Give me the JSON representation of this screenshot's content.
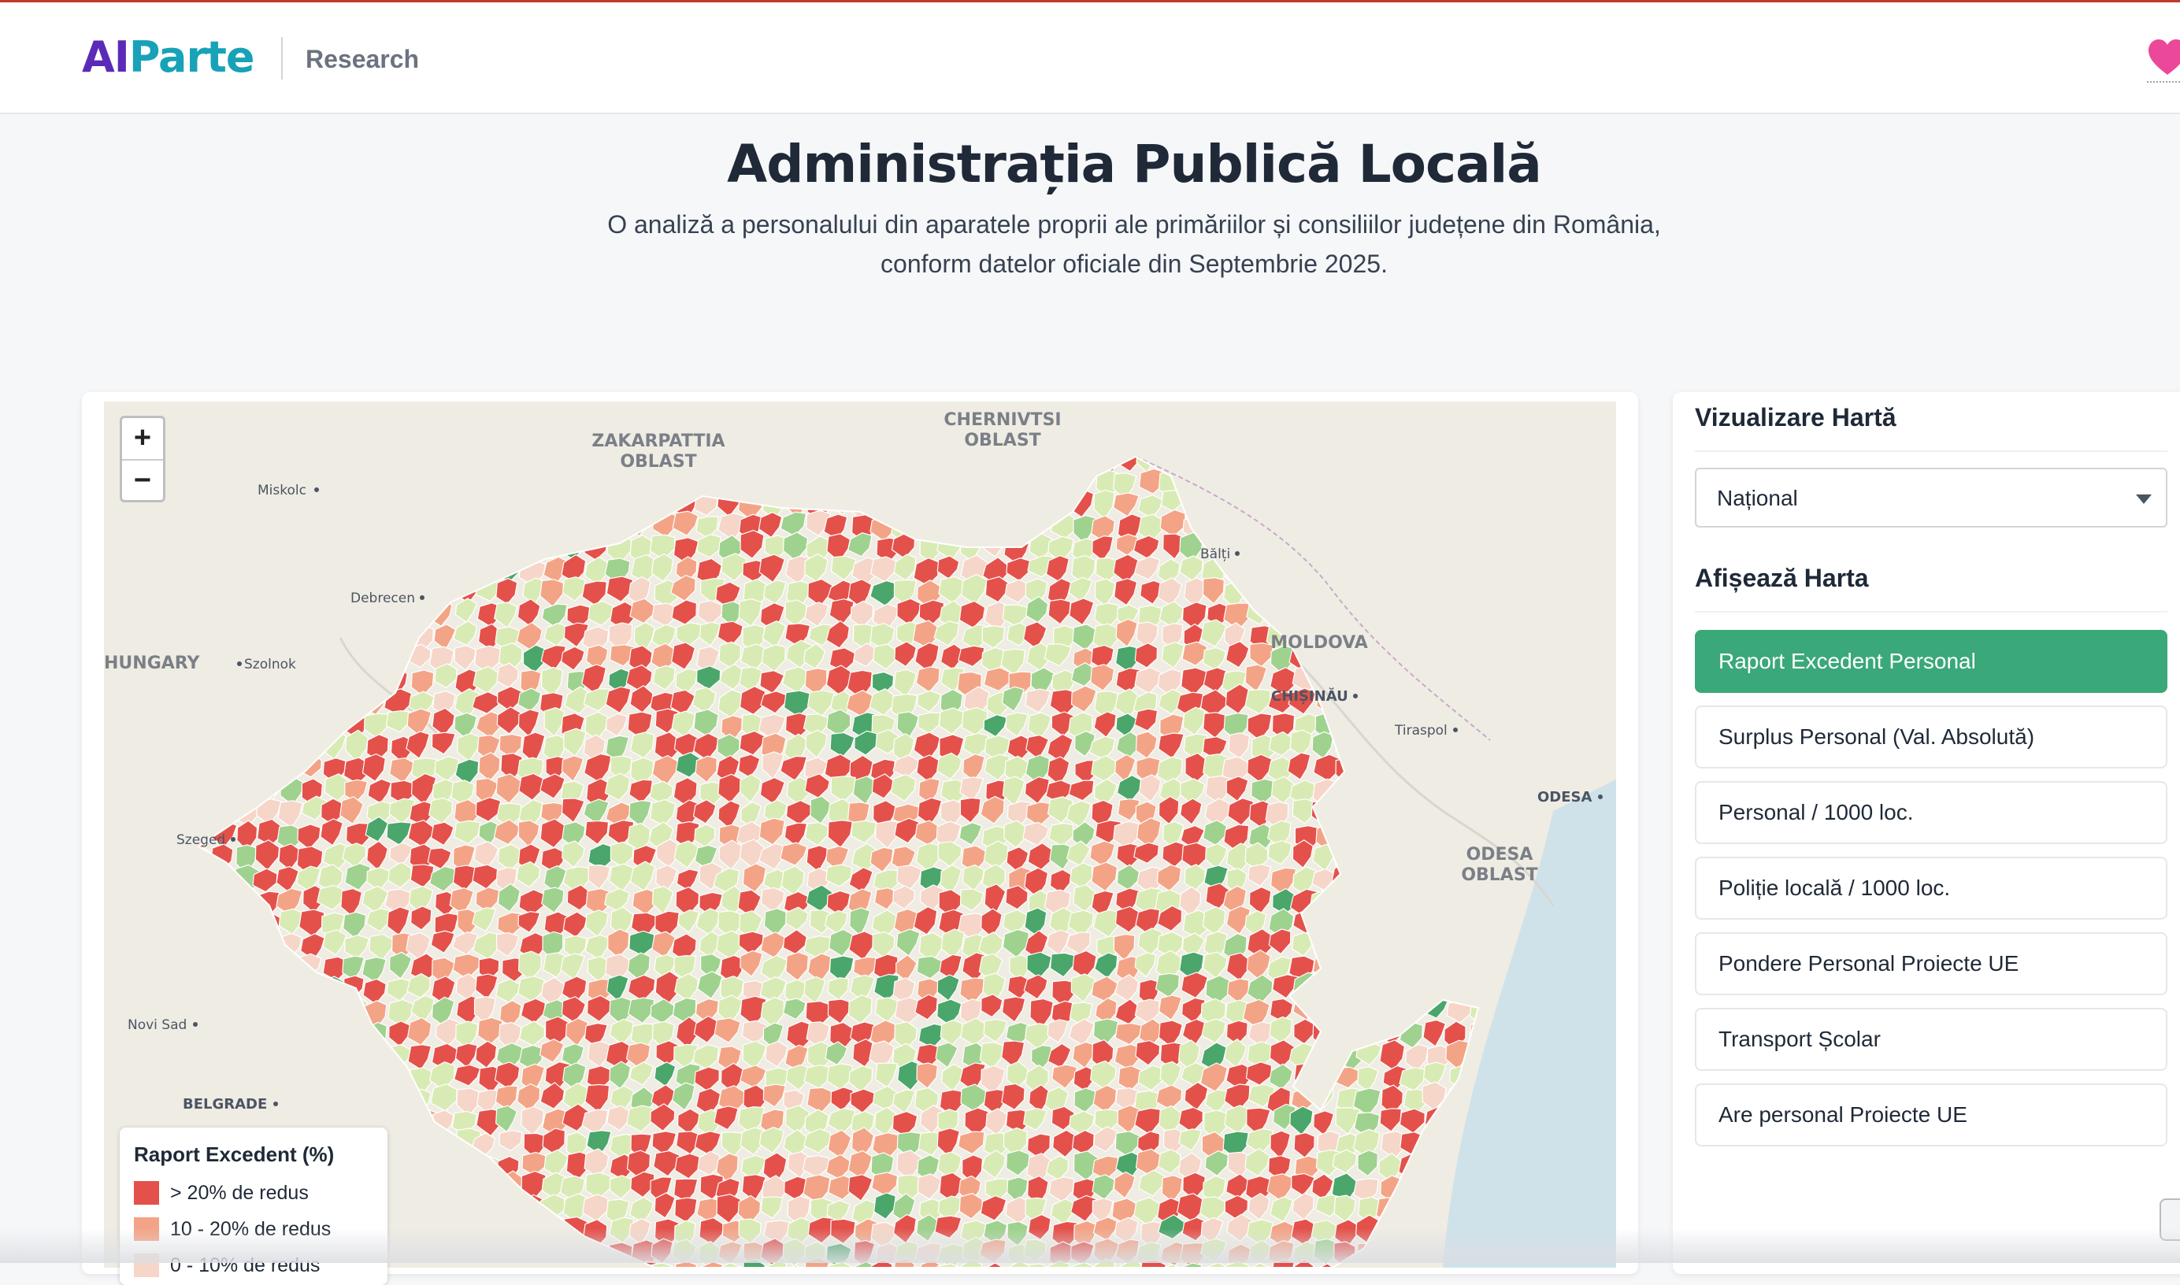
{
  "header": {
    "logo_ai": "AI",
    "logo_parte": "Parte",
    "section": "Research"
  },
  "page": {
    "title": "Administrația Publică Locală",
    "subtitle_line1": "O analiză a personalului din aparatele proprii ale primăriilor și consiliilor județene din România,",
    "subtitle_line2": "conform datelor oficiale din Septembrie 2025."
  },
  "map": {
    "zoom_in": "+",
    "zoom_out": "−",
    "places": [
      {
        "name": "ZAKARPATTIA",
        "kind": "region"
      },
      {
        "name": "OBLAST",
        "kind": "region"
      },
      {
        "name": "CHERNIVTSI",
        "kind": "region"
      },
      {
        "name": "OBLAST",
        "kind": "region"
      },
      {
        "name": "Miskolc",
        "kind": "city"
      },
      {
        "name": "Debrecen",
        "kind": "city"
      },
      {
        "name": "HUNGARY",
        "kind": "country"
      },
      {
        "name": "Szolnok",
        "kind": "city"
      },
      {
        "name": "Bălți",
        "kind": "city"
      },
      {
        "name": "MOLDOVA",
        "kind": "country"
      },
      {
        "name": "CHIȘINĂU",
        "kind": "capital"
      },
      {
        "name": "Tiraspol",
        "kind": "city"
      },
      {
        "name": "ODESA",
        "kind": "capital"
      },
      {
        "name": "ODESA",
        "kind": "region"
      },
      {
        "name": "OBLAST",
        "kind": "region"
      },
      {
        "name": "Szeged",
        "kind": "city"
      },
      {
        "name": "Novi Sad",
        "kind": "city"
      },
      {
        "name": "BELGRADE",
        "kind": "capital"
      }
    ],
    "legend": {
      "title": "Raport Excedent (%)",
      "items": [
        {
          "label": "> 20% de redus",
          "color": "#e4514b"
        },
        {
          "label": "10 - 20% de redus",
          "color": "#f4a486"
        },
        {
          "label": "0 - 10% de redus",
          "color": "#f6d6c9"
        }
      ]
    },
    "colors": {
      "high_excess": "#e4514b",
      "mid_excess": "#f4a486",
      "low_excess": "#f6d6c9",
      "light_deficit": "#d9ebb4",
      "mid_deficit": "#9fd28e",
      "high_deficit": "#4aa66a",
      "sea": "#cfe2ea",
      "land": "#efece4",
      "borders": "#ffffff"
    }
  },
  "sidebar": {
    "view_heading": "Vizualizare Hartă",
    "select_value": "Național",
    "show_heading": "Afișează Harta",
    "active_color": "#3aa878",
    "buttons": [
      {
        "label": "Raport Excedent Personal",
        "active": true
      },
      {
        "label": "Surplus Personal (Val. Absolută)",
        "active": false
      },
      {
        "label": "Personal / 1000 loc.",
        "active": false
      },
      {
        "label": "Poliție locală / 1000 loc.",
        "active": false
      },
      {
        "label": "Pondere Personal Proiecte UE",
        "active": false
      },
      {
        "label": "Transport Școlar",
        "active": false
      },
      {
        "label": "Are personal Proiecte UE",
        "active": false
      }
    ]
  }
}
